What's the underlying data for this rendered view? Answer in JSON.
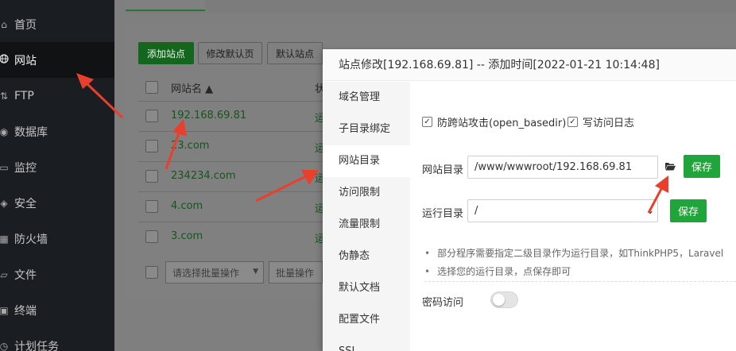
{
  "sidebar": {
    "items": [
      {
        "label": "首页",
        "icon": "home-icon"
      },
      {
        "label": "网站",
        "icon": "globe-icon",
        "active": true
      },
      {
        "label": "FTP",
        "icon": "ftp-icon"
      },
      {
        "label": "数据库",
        "icon": "database-icon"
      },
      {
        "label": "监控",
        "icon": "monitor-icon"
      },
      {
        "label": "安全",
        "icon": "shield-icon"
      },
      {
        "label": "防火墙",
        "icon": "firewall-icon"
      },
      {
        "label": "文件",
        "icon": "folder-icon"
      },
      {
        "label": "终端",
        "icon": "terminal-icon"
      },
      {
        "label": "计划任务",
        "icon": "clock-icon"
      }
    ]
  },
  "toolbar": {
    "add_site": "添加站点",
    "edit_default_page": "修改默认页",
    "default_site": "默认站点"
  },
  "site_table": {
    "header_name": "网站名 ▲",
    "header_status": "状",
    "rows": [
      {
        "name": "192.168.69.81",
        "status": "运"
      },
      {
        "name": "23.com",
        "status": "运"
      },
      {
        "name": "234234.com",
        "status": "运"
      },
      {
        "name": "4.com",
        "status": "运"
      },
      {
        "name": "3.com",
        "status": "运"
      }
    ],
    "batch_placeholder": "请选择批量操作",
    "batch_button": "批量操作"
  },
  "dialog": {
    "title": "站点修改[192.168.69.81] -- 添加时间[2022-01-21 10:14:48]",
    "nav": [
      "域名管理",
      "子目录绑定",
      "网站目录",
      "访问限制",
      "流量限制",
      "伪静态",
      "默认文档",
      "配置文件",
      "SSL"
    ],
    "active_nav": "网站目录",
    "anti_xss_label": "防跨站攻击(open_basedir)",
    "anti_xss_checked": true,
    "access_log_label": "写访问日志",
    "access_log_checked": true,
    "site_dir_label": "网站目录",
    "site_dir_value": "/www/wwwroot/192.168.69.81",
    "save_label": "保存",
    "run_dir_label": "运行目录",
    "run_dir_value": "/",
    "hints": [
      "部分程序需要指定二级目录作为运行目录，如ThinkPHP5，Laravel",
      "选择您的运行目录，点保存即可"
    ],
    "password_access_label": "密码访问",
    "password_access_enabled": false
  },
  "colors": {
    "accent_green": "#20a53a",
    "annotation_red": "#e8402c",
    "sidebar_bg": "#1a1e22"
  }
}
